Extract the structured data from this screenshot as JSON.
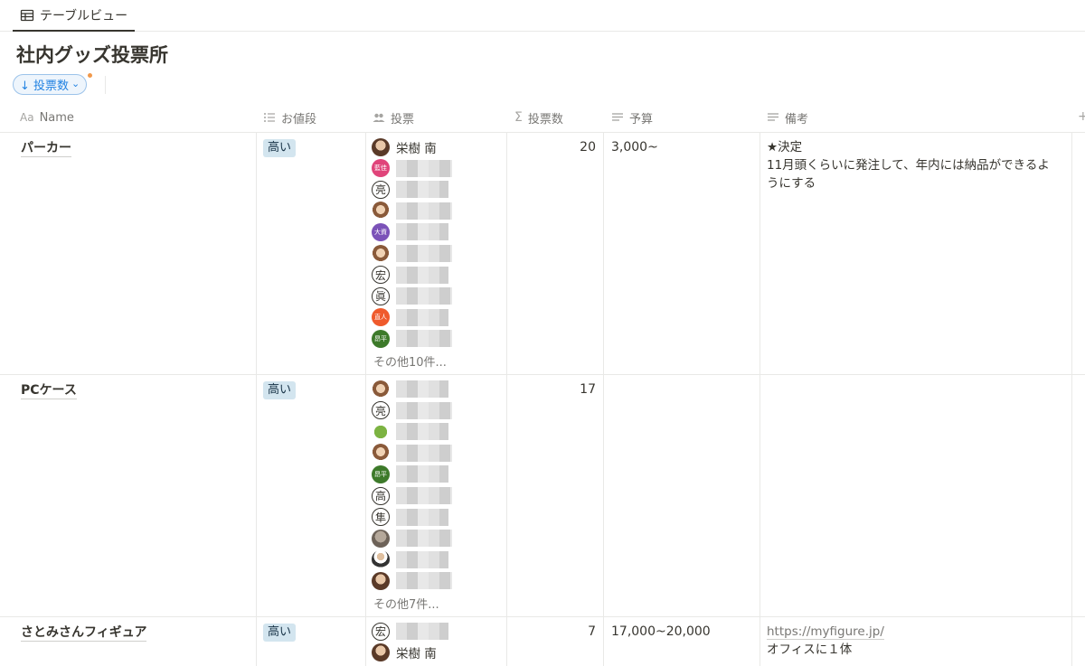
{
  "tab": {
    "label": "テーブルビュー",
    "icon": "table-icon"
  },
  "title": "社内グッズ投票所",
  "sort": {
    "label": "↓ 投票数",
    "chevron": "⌄"
  },
  "columns": [
    {
      "icon": "Aa",
      "label": "Name"
    },
    {
      "icon": "list-icon",
      "label": "お値段"
    },
    {
      "icon": "people-icon",
      "label": "投票"
    },
    {
      "icon": "Σ",
      "label": "投票数"
    },
    {
      "icon": "text-icon",
      "label": "予算"
    },
    {
      "icon": "text-icon",
      "label": "備考"
    }
  ],
  "rows": [
    {
      "name": "パーカー",
      "price": "高い",
      "vote_count": "20",
      "budget": "3,000~",
      "notes": [
        "★決定",
        "11月頭くらいに発注して、年内には納品ができるようにする"
      ],
      "voters": [
        {
          "avatar": "photo",
          "label": "",
          "name": "栄樹 南"
        },
        {
          "avatar": "color",
          "label": "藍佳",
          "color": "#e0447a"
        },
        {
          "avatar": "kanji",
          "label": "亮"
        },
        {
          "avatar": "photo2",
          "label": ""
        },
        {
          "avatar": "color",
          "label": "大資",
          "color": "#7b52b8"
        },
        {
          "avatar": "photo2",
          "label": ""
        },
        {
          "avatar": "kanji",
          "label": "宏"
        },
        {
          "avatar": "kanji",
          "label": "眞"
        },
        {
          "avatar": "color",
          "label": "直人",
          "color": "#ef5a2c"
        },
        {
          "avatar": "color",
          "label": "昂平",
          "color": "#3d7a2a"
        }
      ],
      "more": "その他10件..."
    },
    {
      "name": "PCケース",
      "price": "高い",
      "vote_count": "17",
      "budget": "",
      "notes": [],
      "voters": [
        {
          "avatar": "photo2",
          "label": ""
        },
        {
          "avatar": "kanji",
          "label": "亮"
        },
        {
          "avatar": "veg",
          "label": ""
        },
        {
          "avatar": "photo2",
          "label": ""
        },
        {
          "avatar": "color",
          "label": "昂平",
          "color": "#3d7a2a"
        },
        {
          "avatar": "kanji",
          "label": "高"
        },
        {
          "avatar": "kanji",
          "label": "隼"
        },
        {
          "avatar": "photo3",
          "label": ""
        },
        {
          "avatar": "suit",
          "label": ""
        },
        {
          "avatar": "photo",
          "label": ""
        }
      ],
      "more": "その他7件..."
    },
    {
      "name": "さとみさんフィギュア",
      "price": "高い",
      "vote_count": "7",
      "budget": "17,000~20,000",
      "notes_link": "https://myfigure.jp/",
      "notes": [
        "オフィスに１体"
      ],
      "voters": [
        {
          "avatar": "kanji",
          "label": "宏"
        },
        {
          "avatar": "photo",
          "label": "",
          "name": "栄樹 南"
        }
      ],
      "more": ""
    }
  ]
}
